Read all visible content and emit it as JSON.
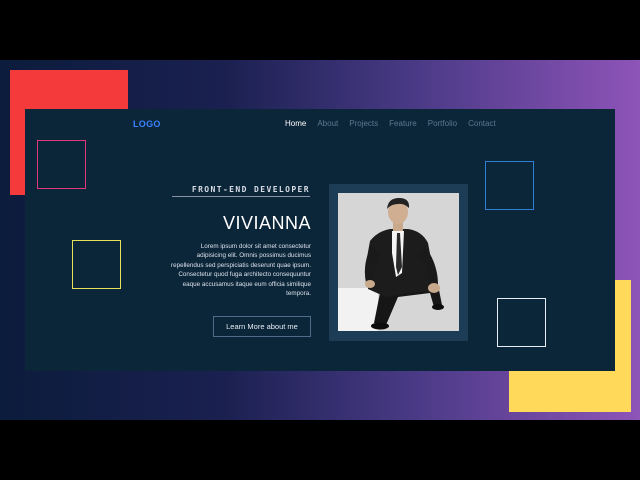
{
  "header": {
    "logo": "LOGO",
    "nav": [
      {
        "label": "Home",
        "active": true
      },
      {
        "label": "About",
        "active": false
      },
      {
        "label": "Projects",
        "active": false
      },
      {
        "label": "Feature",
        "active": false
      },
      {
        "label": "Portfolio",
        "active": false
      },
      {
        "label": "Contact",
        "active": false
      }
    ]
  },
  "hero": {
    "subtitle": "FRONT-END DEVELOPER",
    "name": "VIVIANNA",
    "bio": "Lorem ipsum dolor sit amet consectetur adipisicing elit. Omnis possimus ducimus repellendus sed perspiciatis deserunt quae ipsum. Consectetur quod fuga architecto consequuntur eaque accusamus itaque eum officia similique tempora.",
    "cta_label": "Learn More about me",
    "photo_icon": "portrait-photo"
  },
  "colors": {
    "card_bg": "#0b2539",
    "accent_logo": "#3a82ff",
    "block_red": "#f43a3a",
    "block_yellow": "#ffd95a",
    "square_pink": "#e0367a",
    "square_yellow": "#e6e05a",
    "square_blue": "#2f7fd8",
    "square_white": "#e8eef5"
  }
}
